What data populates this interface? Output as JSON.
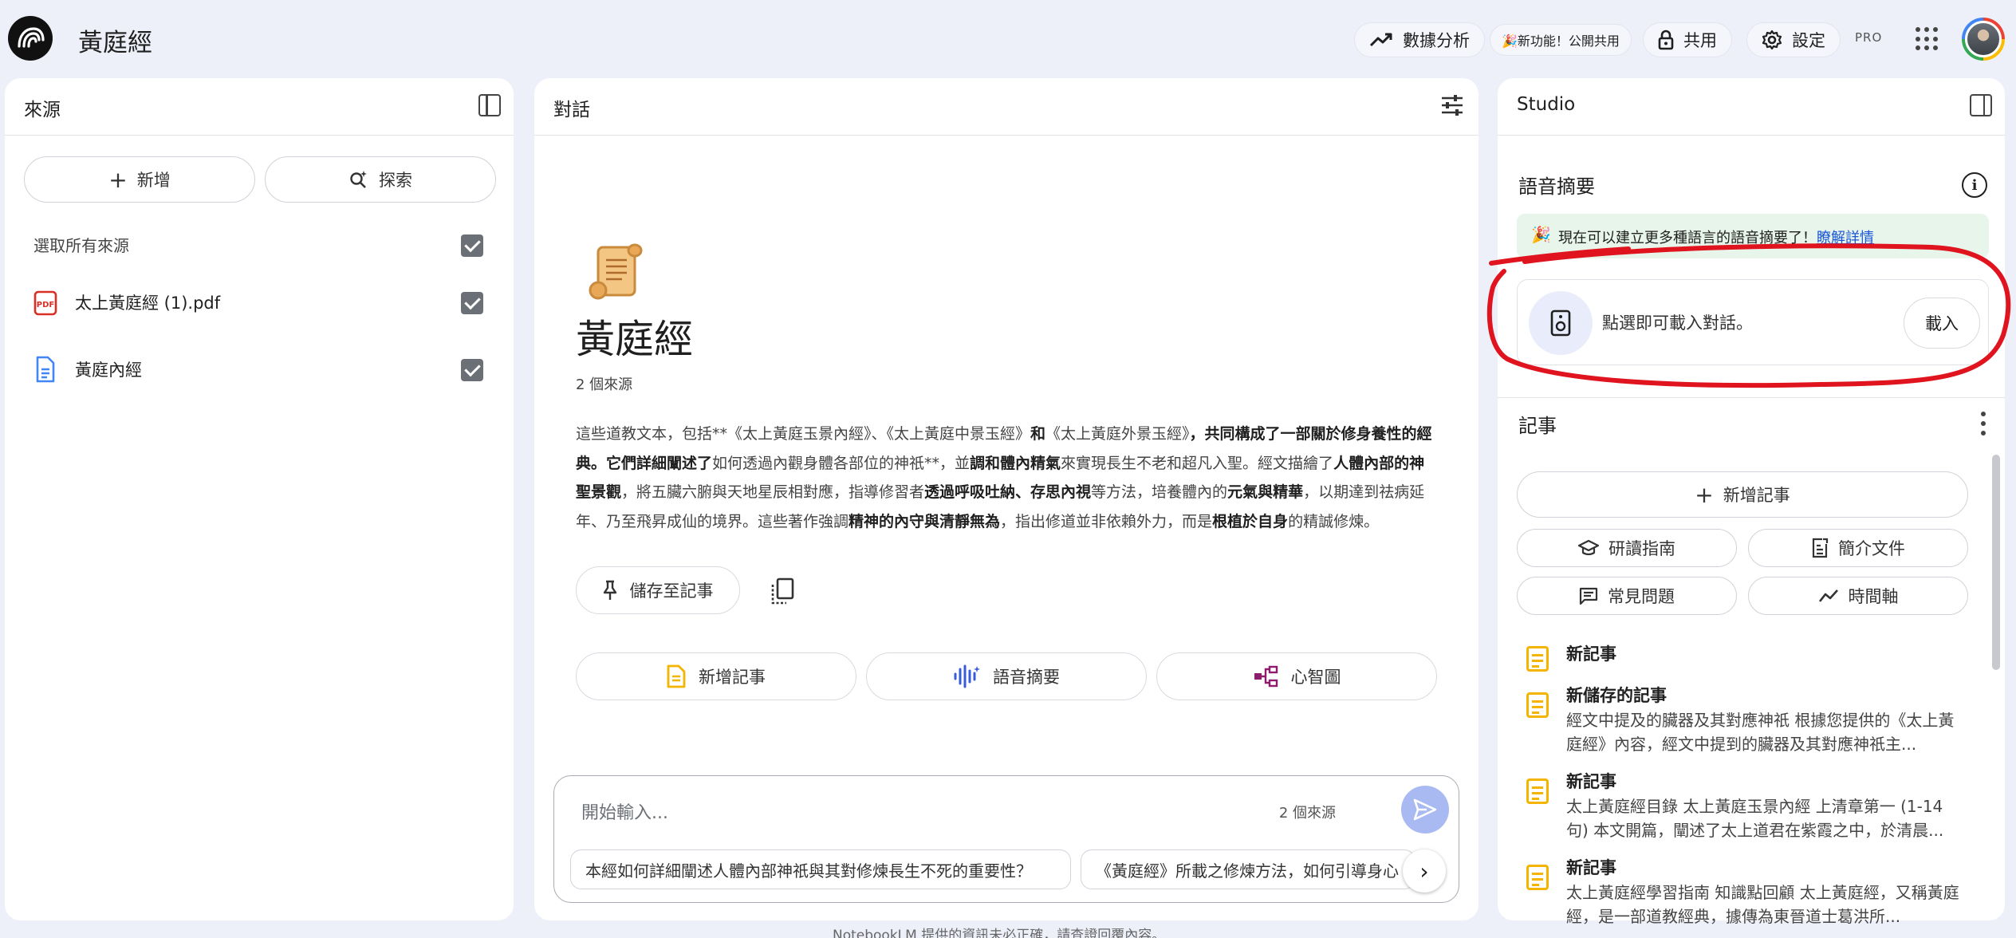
{
  "header": {
    "app_title": "黃庭經",
    "analytics": "數據分析",
    "new_feature": "🎉新功能！公開共用",
    "share": "共用",
    "settings": "設定",
    "pro": "PRO"
  },
  "sources": {
    "title": "來源",
    "add": "新增",
    "explore": "探索",
    "select_all": "選取所有來源",
    "items": [
      {
        "label": "太上黃庭經 (1).pdf",
        "type": "pdf",
        "checked": true
      },
      {
        "label": "黃庭內經",
        "type": "doc",
        "checked": true
      }
    ]
  },
  "chat": {
    "title": "對話",
    "notebook_title": "黃庭經",
    "source_count": "2 個來源",
    "summary_parts": [
      {
        "t": "這些道教文本，包括**《太上黃庭玉景內經》、《太上黃庭中景玉經》",
        "b": false
      },
      {
        "t": "和",
        "b": true
      },
      {
        "t": "《太上黃庭外景玉經》",
        "b": false
      },
      {
        "t": "，共同構成了一部關於修身養性的經典。它們詳細闡述了",
        "b": true
      },
      {
        "t": "如何透過內觀身體各部位的神祇**，並",
        "b": false
      },
      {
        "t": "調和體內精氣",
        "b": true
      },
      {
        "t": "來實現長生不老和超凡入聖。經文描繪了",
        "b": false
      },
      {
        "t": "人體內部的神聖景觀",
        "b": true
      },
      {
        "t": "，將五臟六腑與天地星辰相對應，指導修習者",
        "b": false
      },
      {
        "t": "透過呼吸吐納、存思內視",
        "b": true
      },
      {
        "t": "等方法，培養體內的",
        "b": false
      },
      {
        "t": "元氣與精華",
        "b": true
      },
      {
        "t": "，以期達到祛病延年、乃至飛昇成仙的境界。這些著作強調",
        "b": false
      },
      {
        "t": "精神的內守與清靜無為",
        "b": true
      },
      {
        "t": "，指出修道並非依賴外力，而是",
        "b": false
      },
      {
        "t": "根植於自身",
        "b": true
      },
      {
        "t": "的精誠修煉。",
        "b": false
      }
    ],
    "save_to_note": "儲存至記事",
    "actions": {
      "add_note": "新增記事",
      "audio_overview": "語音摘要",
      "mind_map": "心智圖"
    },
    "input_placeholder": "開始輸入...",
    "input_source_count": "2 個來源",
    "suggestions": [
      "本經如何詳細闡述人體內部神祇與其對修煉長生不死的重要性？",
      "《黃庭經》所載之修煉方法，如何引導身心"
    ],
    "disclaimer": "NotebookLM 提供的資訊未必正確，請查證回覆內容。"
  },
  "studio": {
    "title": "Studio",
    "audio_section": "語音摘要",
    "banner_text": "現在可以建立更多種語言的語音摘要了！",
    "banner_link": "瞭解詳情",
    "audio_card_text": "點選即可載入對話。",
    "load": "載入",
    "notes_section": "記事",
    "add_note": "新增記事",
    "buttons": {
      "study_guide": "研讀指南",
      "briefing": "簡介文件",
      "faq": "常見問題",
      "timeline": "時間軸"
    },
    "notes": [
      {
        "title": "新記事",
        "body": ""
      },
      {
        "title": "新儲存的記事",
        "body": "經文中提及的臟器及其對應神祇 根據您提供的《太上黃庭經》內容，經文中提到的臟器及其對應神祇主..."
      },
      {
        "title": "新記事",
        "body": "太上黃庭經目錄 太上黃庭玉景內經 上清章第一 (1-14句) 本文開篇，闡述了太上道君在紫霞之中，於清晨..."
      },
      {
        "title": "新記事",
        "body": "太上黃庭經學習指南 知識點回顧 太上黃庭經，又稱黃庭經，是一部道教經典，據傳為東晉道士葛洪所..."
      }
    ]
  },
  "colors": {
    "accent": "#1a73e8",
    "note_icon": "#f4b400",
    "annotation": "#e0141e",
    "send": "#a9b9f2"
  }
}
